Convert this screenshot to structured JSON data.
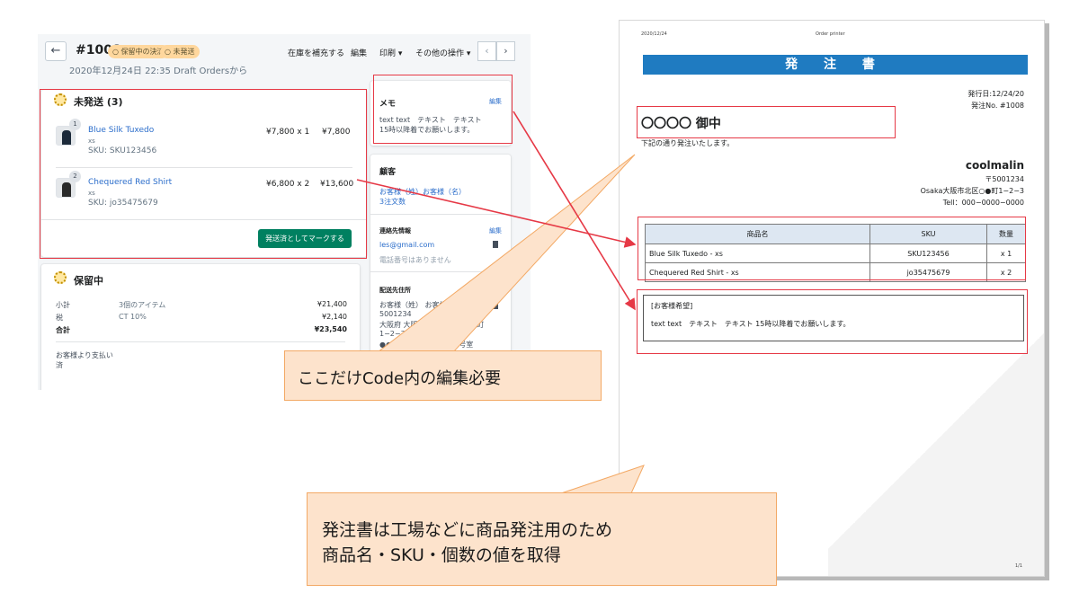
{
  "admin": {
    "order_no": "#1008",
    "badge_payment": "保留中の決済",
    "badge_fulfillment": "未発送",
    "order_date": "2020年12月24日 22:35 Draft Ordersから",
    "toolbar": {
      "restock": "在庫を補充する",
      "edit": "編集",
      "print": "印刷 ▾",
      "more": "その他の操作 ▾"
    },
    "unfulfilled": {
      "title": "未発送 (3)",
      "items": [
        {
          "qty_badge": "1",
          "name": "Blue Silk Tuxedo",
          "variant": "xs",
          "sku": "SKU: SKU123456",
          "unit": "¥7,800 x 1",
          "total": "¥7,800"
        },
        {
          "qty_badge": "2",
          "name": "Chequered Red Shirt",
          "variant": "xs",
          "sku": "SKU: jo35475679",
          "unit": "¥6,800 x 2",
          "total": "¥13,600"
        }
      ],
      "button": "発送済としてマークする"
    },
    "pending": {
      "title": "保留中",
      "rows": [
        {
          "label": "小計",
          "mid": "3個のアイテム",
          "value": "¥21,400"
        },
        {
          "label": "税",
          "mid": "CT 10%",
          "value": "¥2,140"
        },
        {
          "label": "合計",
          "mid": "",
          "value": "¥23,540"
        }
      ],
      "paid_label": "お客様より支払い",
      "paid_sub": "済"
    },
    "memo": {
      "title": "メモ",
      "edit": "編集",
      "line1": "text text　テキスト　テキスト",
      "line2": "15時以降着でお願いします。"
    },
    "customer": {
      "title": "顧客",
      "name": "お客様（姓）お客様（名）",
      "orders": "3注文数",
      "contact_title": "連絡先情報",
      "contact_edit": "編集",
      "email": "les@gmail.com",
      "phone": "電話番号はありません",
      "ship_title": "配送先住所",
      "ship_edit": "編集",
      "ship_lines": [
        "お客様（姓） お客様（名）",
        "5001234",
        "大阪府 大阪府大阪市 港区〇●町",
        "1−2−3",
        "●●●●マンション1008号室"
      ]
    }
  },
  "document": {
    "date": "2020/12/24",
    "header_mid": "Order printer",
    "title": "発 注 書",
    "issue_date": "発行日:12/24/20",
    "po_no": "発注No. #1008",
    "addressee": "〇〇〇〇 御中",
    "intro": "下記の通り発注いたします。",
    "company": "coolmalin",
    "postal": "〒5001234",
    "address": "Osaka大阪市北区○●町1−2−3",
    "tel": "Tell：000−0000−0000",
    "table": {
      "headers": [
        "商品名",
        "SKU",
        "数量"
      ],
      "rows": [
        [
          "Blue Silk Tuxedo - xs",
          "SKU123456",
          "x 1"
        ],
        [
          "Chequered Red Shirt - xs",
          "jo35475679",
          "x 2"
        ]
      ]
    },
    "request_title": "[お客様希望]",
    "request_text": "text text　テキスト　テキスト 15時以降着でお願いします。",
    "page": "1/1"
  },
  "callouts": {
    "small": "ここだけCode内の編集必要",
    "large_line1": "発注書は工場などに商品発注用のため",
    "large_line2": "商品名・SKU・個数の値を取得"
  },
  "colors": {
    "annotation_red": "#e63946",
    "callout_fill": "#fde3cc",
    "callout_border": "#f3a965",
    "doc_title_bar": "#1f7bc1",
    "primary_green": "#008060"
  }
}
